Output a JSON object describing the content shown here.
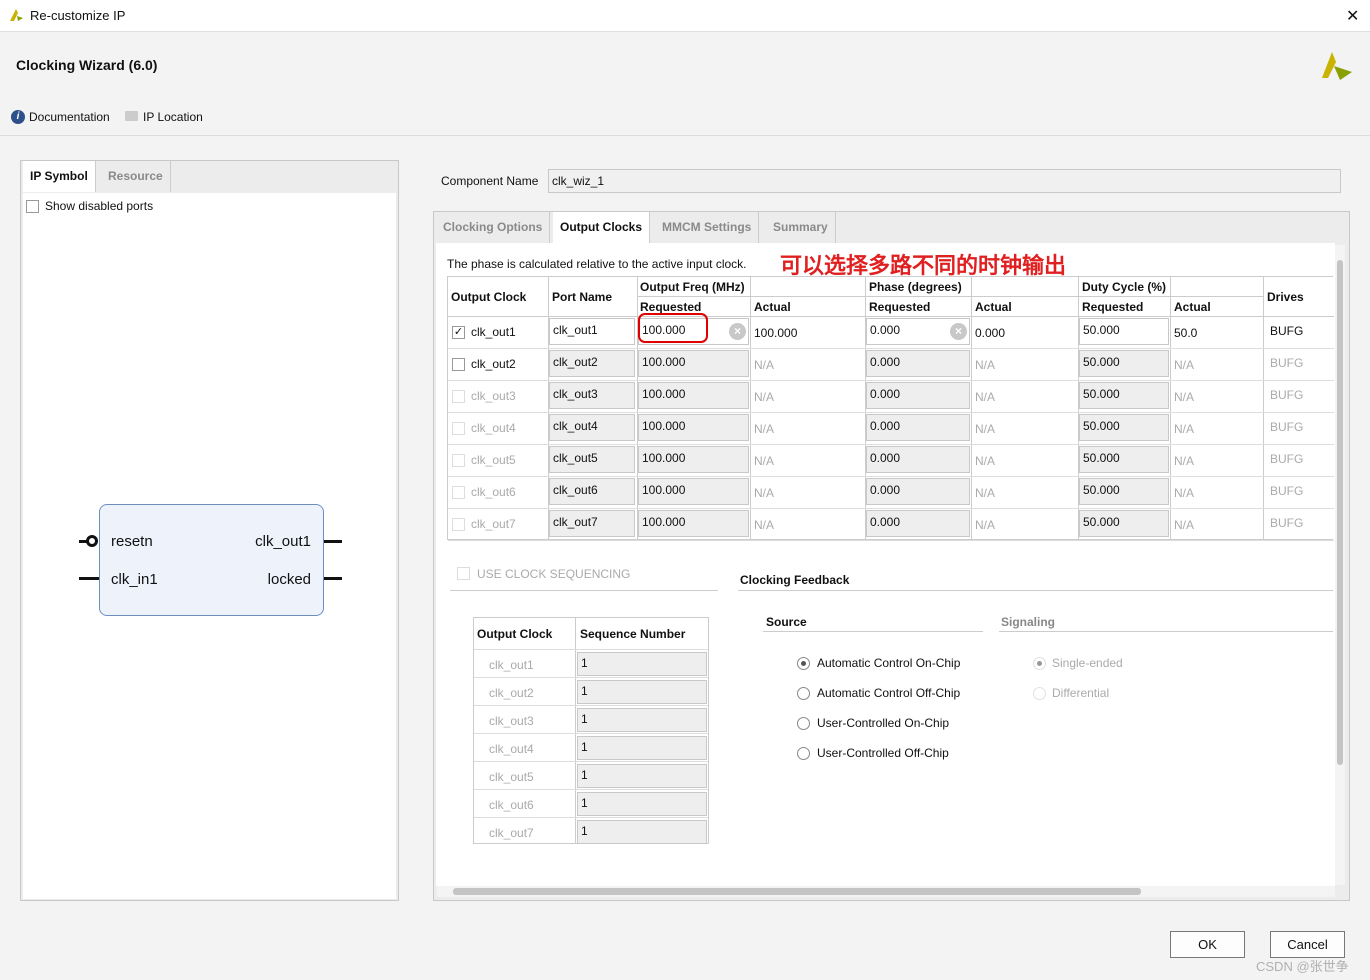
{
  "window": {
    "title": "Re-customize IP",
    "close": "✕"
  },
  "header": {
    "title": "Clocking Wizard (6.0)",
    "documentation": "Documentation",
    "ip_location": "IP Location"
  },
  "left": {
    "tabs": [
      "IP Symbol",
      "Resource"
    ],
    "show_disabled": "Show disabled ports",
    "symbol": {
      "inputs": [
        "resetn",
        "clk_in1"
      ],
      "outputs": [
        "clk_out1",
        "locked"
      ]
    }
  },
  "component": {
    "label": "Component Name",
    "value": "clk_wiz_1"
  },
  "tabs": [
    "Clocking Options",
    "Output Clocks",
    "MMCM Settings",
    "Summary"
  ],
  "note": "The phase is calculated relative to the active input clock.",
  "annotation": "可以选择多路不同的时钟输出",
  "table": {
    "headers": {
      "output_clock": "Output Clock",
      "port_name": "Port Name",
      "freq": "Output Freq (MHz)",
      "phase": "Phase (degrees)",
      "duty": "Duty Cycle (%)",
      "drives": "Drives",
      "requested": "Requested",
      "actual": "Actual"
    },
    "rows": [
      {
        "enabled": true,
        "checked": true,
        "clock": "clk_out1",
        "port": "clk_out1",
        "freq_req": "100.000",
        "freq_act": "100.000",
        "phase_req": "0.000",
        "phase_act": "0.000",
        "duty_req": "50.000",
        "duty_act": "50.0",
        "drives": "BUFG"
      },
      {
        "enabled": true,
        "checked": false,
        "clock": "clk_out2",
        "port": "clk_out2",
        "freq_req": "100.000",
        "freq_act": "N/A",
        "phase_req": "0.000",
        "phase_act": "N/A",
        "duty_req": "50.000",
        "duty_act": "N/A",
        "drives": "BUFG"
      },
      {
        "enabled": false,
        "checked": false,
        "clock": "clk_out3",
        "port": "clk_out3",
        "freq_req": "100.000",
        "freq_act": "N/A",
        "phase_req": "0.000",
        "phase_act": "N/A",
        "duty_req": "50.000",
        "duty_act": "N/A",
        "drives": "BUFG"
      },
      {
        "enabled": false,
        "checked": false,
        "clock": "clk_out4",
        "port": "clk_out4",
        "freq_req": "100.000",
        "freq_act": "N/A",
        "phase_req": "0.000",
        "phase_act": "N/A",
        "duty_req": "50.000",
        "duty_act": "N/A",
        "drives": "BUFG"
      },
      {
        "enabled": false,
        "checked": false,
        "clock": "clk_out5",
        "port": "clk_out5",
        "freq_req": "100.000",
        "freq_act": "N/A",
        "phase_req": "0.000",
        "phase_act": "N/A",
        "duty_req": "50.000",
        "duty_act": "N/A",
        "drives": "BUFG"
      },
      {
        "enabled": false,
        "checked": false,
        "clock": "clk_out6",
        "port": "clk_out6",
        "freq_req": "100.000",
        "freq_act": "N/A",
        "phase_req": "0.000",
        "phase_act": "N/A",
        "duty_req": "50.000",
        "duty_act": "N/A",
        "drives": "BUFG"
      },
      {
        "enabled": false,
        "checked": false,
        "clock": "clk_out7",
        "port": "clk_out7",
        "freq_req": "100.000",
        "freq_act": "N/A",
        "phase_req": "0.000",
        "phase_act": "N/A",
        "duty_req": "50.000",
        "duty_act": "N/A",
        "drives": "BUFG"
      }
    ]
  },
  "sequencing": {
    "label": "USE CLOCK SEQUENCING",
    "headers": [
      "Output Clock",
      "Sequence Number"
    ],
    "rows": [
      [
        "clk_out1",
        "1"
      ],
      [
        "clk_out2",
        "1"
      ],
      [
        "clk_out3",
        "1"
      ],
      [
        "clk_out4",
        "1"
      ],
      [
        "clk_out5",
        "1"
      ],
      [
        "clk_out6",
        "1"
      ],
      [
        "clk_out7",
        "1"
      ]
    ]
  },
  "feedback": {
    "title": "Clocking Feedback",
    "source_label": "Source",
    "signaling_label": "Signaling",
    "source": [
      "Automatic Control On-Chip",
      "Automatic Control Off-Chip",
      "User-Controlled On-Chip",
      "User-Controlled Off-Chip"
    ],
    "source_selected": 0,
    "signaling": [
      "Single-ended",
      "Differential"
    ],
    "signaling_selected": 0
  },
  "buttons": {
    "ok": "OK",
    "cancel": "Cancel"
  },
  "watermark": "CSDN @张世争",
  "colors": {
    "annotation": "#e02020",
    "highlight": "#e00000",
    "symbol_fill": "#eef3fb",
    "symbol_border": "#6d8fc0"
  }
}
